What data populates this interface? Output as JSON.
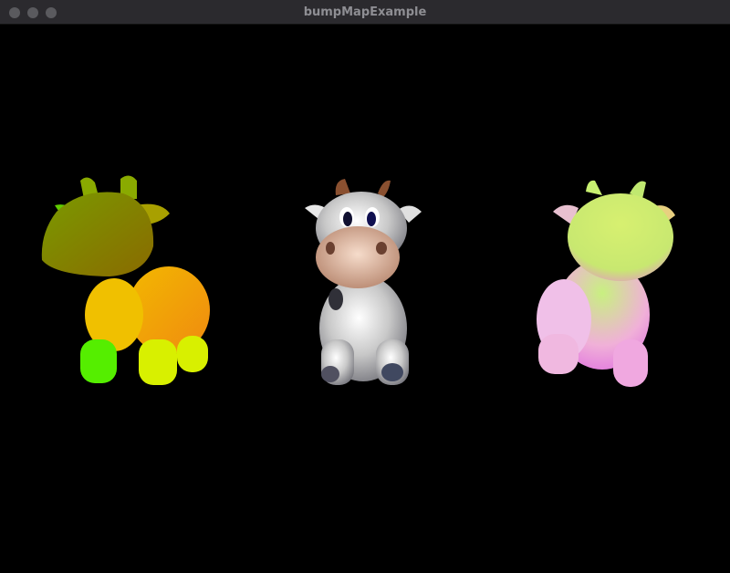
{
  "window": {
    "title": "bumpMapExample"
  },
  "scene": {
    "models": [
      {
        "name": "uv-shaded-cow"
      },
      {
        "name": "textured-cow"
      },
      {
        "name": "normal-shaded-cow"
      }
    ]
  }
}
